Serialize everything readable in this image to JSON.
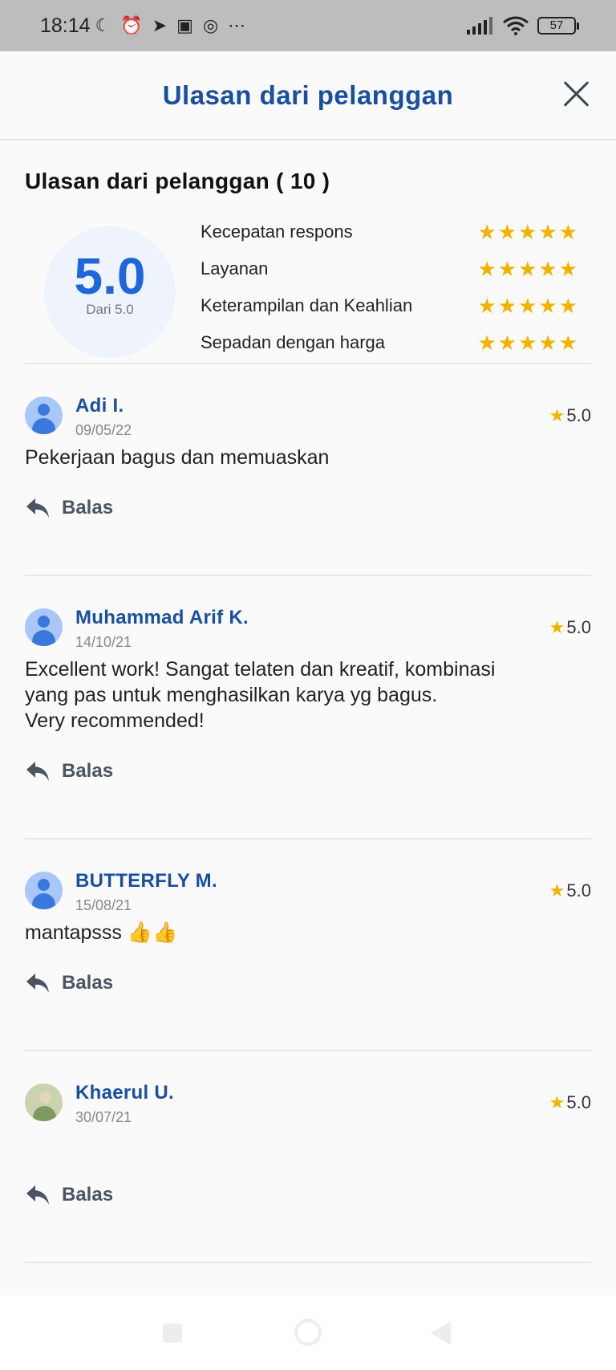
{
  "status_bar": {
    "time": "18:14",
    "battery": "57",
    "more": "⋯"
  },
  "header": {
    "title": "Ulasan dari pelanggan"
  },
  "summary": {
    "section_title": "Ulasan dari pelanggan ( 10 )",
    "score": "5.0",
    "score_sub": "Dari 5.0",
    "criteria": [
      {
        "label": "Kecepatan respons",
        "stars": 5
      },
      {
        "label": "Layanan",
        "stars": 5
      },
      {
        "label": "Keterampilan dan Keahlian",
        "stars": 5
      },
      {
        "label": "Sepadan dengan harga",
        "stars": 5
      }
    ]
  },
  "reviews": [
    {
      "name": "Adi I.",
      "date": "09/05/22",
      "rating": "5.0",
      "text": "Pekerjaan bagus dan memuaskan",
      "reply_label": "Balas",
      "avatar": "default"
    },
    {
      "name": "Muhammad Arif K.",
      "date": "14/10/21",
      "rating": "5.0",
      "text": "Excellent work! Sangat telaten dan kreatif, kombinasi\nyang pas untuk menghasilkan karya yg bagus.\nVery recommended!",
      "reply_label": "Balas",
      "avatar": "default"
    },
    {
      "name": "BUTTERFLY M.",
      "date": "15/08/21",
      "rating": "5.0",
      "text": "mantapsss 👍👍",
      "reply_label": "Balas",
      "avatar": "default"
    },
    {
      "name": "Khaerul U.",
      "date": "30/07/21",
      "rating": "5.0",
      "text": "",
      "reply_label": "Balas",
      "avatar": "photo"
    }
  ],
  "colors": {
    "accent": "#1a4fa0",
    "score": "#1f66d9",
    "star": "#f0b400"
  }
}
